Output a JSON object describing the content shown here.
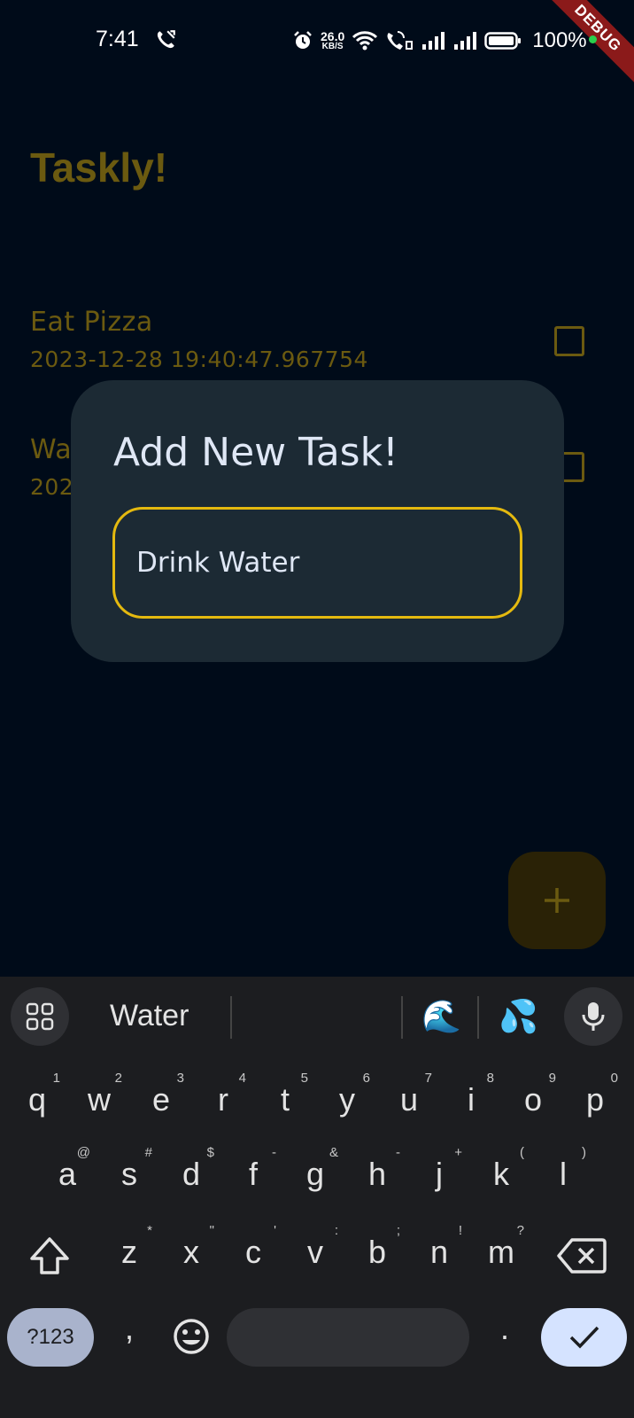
{
  "status_bar": {
    "time": "7:41",
    "net_speed_value": "26.0",
    "net_speed_unit": "KB/S",
    "battery_percent": "100%"
  },
  "debug_banner": "DEBUG",
  "app": {
    "title": "Taskly!",
    "tasks": [
      {
        "name": "Eat Pizza",
        "date": "2023-12-28 19:40:47.967754",
        "done": false
      },
      {
        "name": "Wa",
        "date": "202",
        "done": false
      }
    ]
  },
  "dialog": {
    "title": "Add New Task!",
    "input_value": "Drink Water"
  },
  "fab": {
    "icon": "plus-icon"
  },
  "keyboard": {
    "suggestion": "Water",
    "emoji_suggestions": [
      "🌊",
      "💦"
    ],
    "rows": [
      [
        [
          "q",
          "1"
        ],
        [
          "w",
          "2"
        ],
        [
          "e",
          "3"
        ],
        [
          "r",
          "4"
        ],
        [
          "t",
          "5"
        ],
        [
          "y",
          "6"
        ],
        [
          "u",
          "7"
        ],
        [
          "i",
          "8"
        ],
        [
          "o",
          "9"
        ],
        [
          "p",
          "0"
        ]
      ],
      [
        [
          "a",
          "@"
        ],
        [
          "s",
          "#"
        ],
        [
          "d",
          "$"
        ],
        [
          "f",
          "-"
        ],
        [
          "g",
          "&"
        ],
        [
          "h",
          "-"
        ],
        [
          "j",
          "+"
        ],
        [
          "k",
          "("
        ],
        [
          "l",
          ")"
        ]
      ],
      [
        [
          "z",
          "*"
        ],
        [
          "x",
          "\""
        ],
        [
          "c",
          "'"
        ],
        [
          "v",
          ":"
        ],
        [
          "b",
          ";"
        ],
        [
          "n",
          "!"
        ],
        [
          "m",
          "?"
        ]
      ]
    ],
    "symbols_label": "?123",
    "comma": ",",
    "period": "."
  }
}
